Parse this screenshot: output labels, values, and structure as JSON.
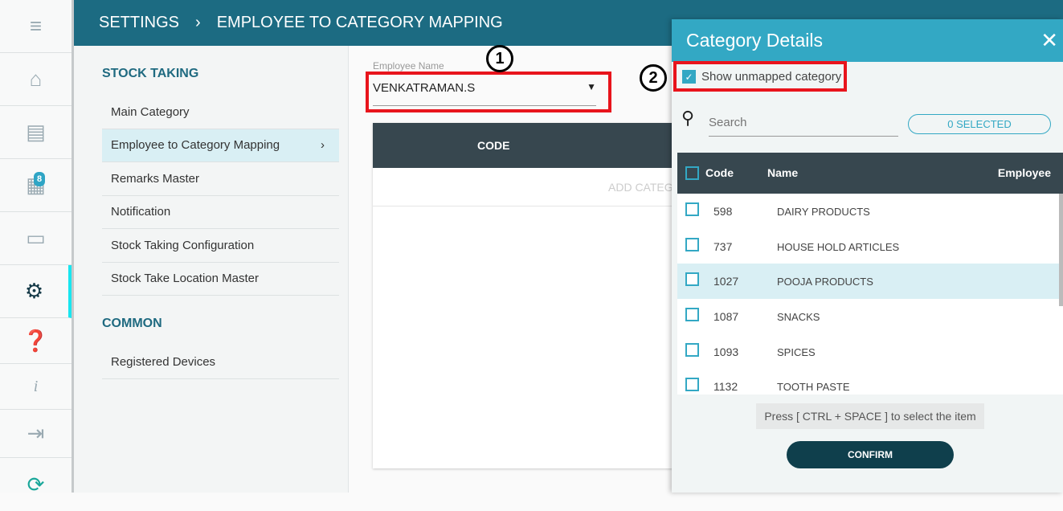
{
  "sidebar": {
    "items": [
      {
        "icon": "menu-icon"
      },
      {
        "icon": "home-icon"
      },
      {
        "icon": "report-icon"
      },
      {
        "icon": "calendar-icon",
        "badge": "8"
      },
      {
        "icon": "box-icon"
      },
      {
        "icon": "gear-icon",
        "active": true
      },
      {
        "icon": "help-icon"
      },
      {
        "icon": "info-icon"
      },
      {
        "icon": "logout-icon"
      },
      {
        "icon": "sync-icon"
      }
    ]
  },
  "header": {
    "breadcrumb": [
      "SETTINGS",
      "EMPLOYEE TO CATEGORY MAPPING"
    ]
  },
  "nav": {
    "sections": [
      {
        "title": "STOCK TAKING",
        "items": [
          "Main Category",
          "Employee to Category Mapping",
          "Remarks Master",
          "Notification",
          "Stock Taking Configuration",
          "Stock Take Location Master"
        ]
      },
      {
        "title": "COMMON",
        "items": [
          "Registered Devices"
        ]
      }
    ]
  },
  "main": {
    "employee_label": "Employee Name",
    "employee_value": "VENKATRAMAN.S",
    "table_header": "CODE",
    "add_text": "ADD CATEGORY"
  },
  "panel": {
    "title": "Category Details",
    "show_unmapped": "Show unmapped category",
    "search_placeholder": "Search",
    "selected": "0 SELECTED",
    "columns": [
      "Code",
      "Name",
      "Employee"
    ],
    "rows": [
      {
        "code": "598",
        "name": "DAIRY PRODUCTS"
      },
      {
        "code": "737",
        "name": "HOUSE HOLD ARTICLES"
      },
      {
        "code": "1027",
        "name": "POOJA PRODUCTS"
      },
      {
        "code": "1087",
        "name": "SNACKS"
      },
      {
        "code": "1093",
        "name": "SPICES"
      },
      {
        "code": "1132",
        "name": "TOOTH PASTE"
      }
    ],
    "hint": "Press [ CTRL + SPACE ] to select the item",
    "confirm": "CONFIRM"
  },
  "annotations": [
    "1",
    "2"
  ]
}
